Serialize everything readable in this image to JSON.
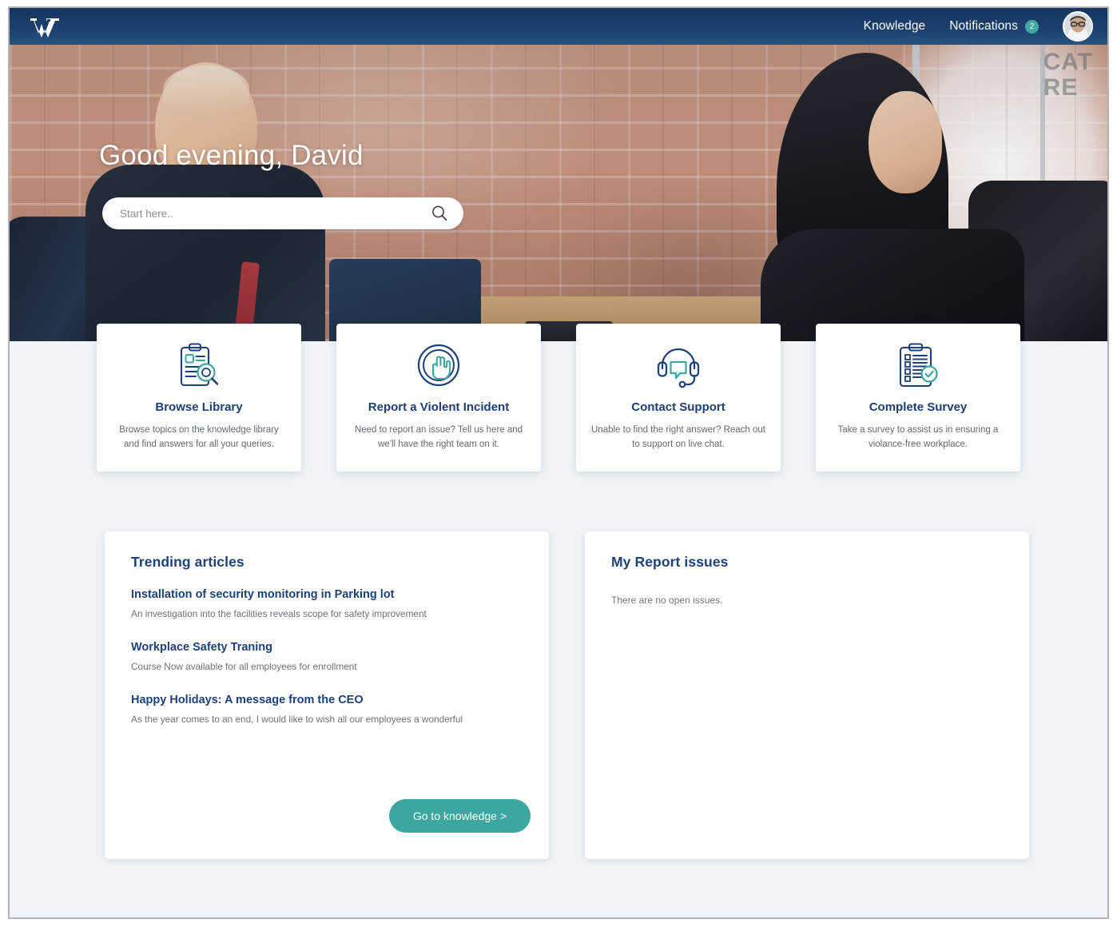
{
  "brand": {
    "logo_name": "wavy-w-logo",
    "accent_teal": "#3ba7a0",
    "navy": "#1d4179"
  },
  "topnav": {
    "knowledge_label": "Knowledge",
    "notifications_label": "Notifications",
    "notifications_count": "2",
    "avatar_name": "David"
  },
  "hero": {
    "greeting": "Good evening, David",
    "search_placeholder": "Start here..",
    "search_value": ""
  },
  "cards": [
    {
      "icon": "clipboard-search-icon",
      "title": "Browse Library",
      "desc": "Browse topics on the knowledge library and find answers for all your queries."
    },
    {
      "icon": "stop-hand-icon",
      "title": "Report a Violent Incident",
      "desc": "Need to report an issue? Tell us here and we'll have the right team on it."
    },
    {
      "icon": "headset-chat-icon",
      "title": "Contact Support",
      "desc": "Unable to find the right answer? Reach out to support on live chat."
    },
    {
      "icon": "clipboard-check-icon",
      "title": "Complete Survey",
      "desc": "Take a survey to assist us in ensuring a violance-free workplace."
    }
  ],
  "trending": {
    "title": "Trending articles",
    "articles": [
      {
        "title": "Installation of security monitoring in Parking lot",
        "sub": "An investigation into the facilities reveals scope for safety improvement"
      },
      {
        "title": "Workplace Safety Traning",
        "sub": "Course Now available for all employees for enrollment"
      },
      {
        "title": "Happy Holidays: A message from the CEO",
        "sub": "As the year comes to an end, I would like to wish all our employees a wonderful"
      }
    ],
    "button_label": "Go to knowledge >"
  },
  "reports": {
    "title": "My Report issues",
    "empty_message": "There are no open issues."
  },
  "hero_photo": {
    "window_sign_line1": "CAT",
    "window_sign_line2": "RE"
  }
}
